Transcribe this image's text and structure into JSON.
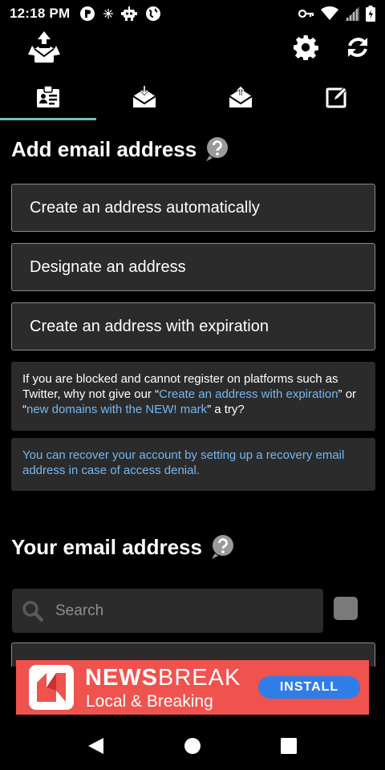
{
  "status_bar": {
    "time": "12:18 PM",
    "left_icons": [
      "p-logo-icon",
      "settings-small-icon",
      "robot-icon",
      "vpn-globe-icon"
    ],
    "right_icons": [
      "vpn-key-icon",
      "wifi-icon",
      "signal-icon",
      "battery-icon"
    ]
  },
  "app_bar": {
    "logo_icon": "recycle-mail-logo-icon",
    "settings_icon": "gear-icon",
    "refresh_icon": "refresh-icon"
  },
  "tabs": [
    {
      "icon": "address-list-icon",
      "active": true
    },
    {
      "icon": "inbox-mail-icon",
      "active": false,
      "has_badge": true
    },
    {
      "icon": "sent-mail-icon",
      "active": false
    },
    {
      "icon": "compose-icon",
      "active": false
    }
  ],
  "add_section": {
    "title": "Add email address",
    "buttons": {
      "auto": "Create an address automatically",
      "designate": "Designate an address",
      "expiration": "Create an address with expiration"
    },
    "info1": {
      "part1": "If you are blocked and cannot register on platforms such as Twitter, why not give our “",
      "link1": "Create an address with expiration",
      "part2": "” or “",
      "link2": "new domains with the NEW! mark",
      "part3": "” a try?"
    },
    "info2": "You can recover your account by setting up a recovery email address in case of access denial."
  },
  "your_section": {
    "title": "Your email address",
    "search_placeholder": "Search"
  },
  "ad": {
    "title_bold": "NEWS",
    "title_light": "BREAK",
    "subtitle": "Local & Breaking",
    "install_label": "INSTALL"
  },
  "colors": {
    "background": "#000000",
    "button_bg": "#2b2b2b",
    "tab_indicator": "#6fc2b6",
    "link": "#76b6f0",
    "ad_bg": "#f0524d",
    "install_bg": "#2f7ee8"
  }
}
